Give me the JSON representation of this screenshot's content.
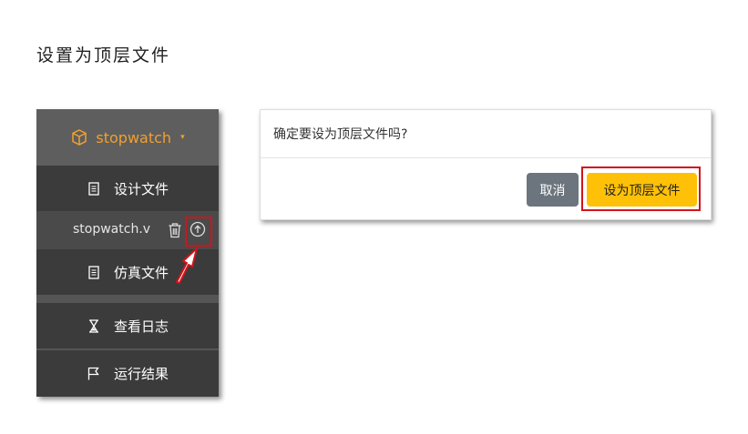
{
  "page": {
    "title": "设置为顶层文件"
  },
  "sidebar": {
    "project": {
      "name": "stopwatch",
      "icon": "box-icon",
      "caret": "▾",
      "accent": "#f0a030"
    },
    "items": [
      {
        "label": "设计文件",
        "icon": "document-icon"
      },
      {
        "label": "仿真文件",
        "icon": "document-icon"
      },
      {
        "label": "查看日志",
        "icon": "hourglass-icon"
      },
      {
        "label": "运行结果",
        "icon": "flag-icon"
      }
    ],
    "file": {
      "name": "stopwatch.v",
      "actions": [
        "trash-icon",
        "upload-circle-icon"
      ]
    }
  },
  "dialog": {
    "message": "确定要设为顶层文件吗?",
    "cancel_label": "取消",
    "confirm_label": "设为顶层文件",
    "colors": {
      "cancel": "#6c757d",
      "confirm": "#ffc107"
    }
  },
  "annotations": {
    "highlight_color": "#d0141a"
  }
}
